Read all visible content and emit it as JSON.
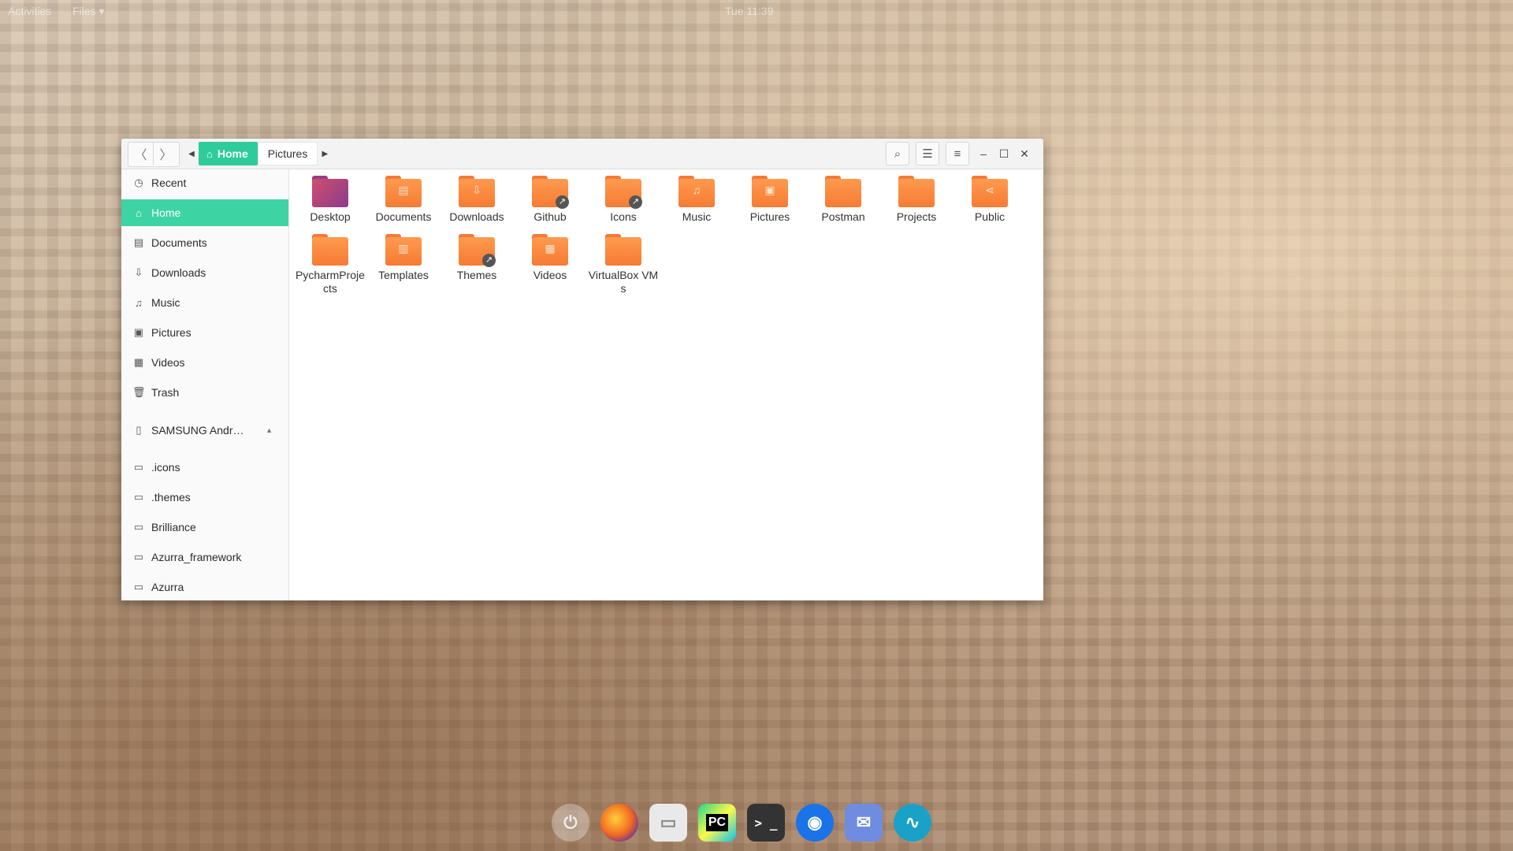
{
  "topbar": {
    "activities": "Activities",
    "app": "Files ▾",
    "clock": "Tue 11:39"
  },
  "window": {
    "nav": {
      "back": "〈",
      "forward": "〉"
    },
    "breadcrumb": {
      "left_arrow": "◀",
      "home_label": "Home",
      "current": "Pictures",
      "right_arrow": "▶"
    },
    "tools": {
      "search": "⌕",
      "view": "☰",
      "menu": "≡"
    },
    "wm": {
      "minimize": "–",
      "maximize": "☐",
      "close": "✕"
    }
  },
  "sidebar": {
    "items": [
      {
        "label": "Recent",
        "icon": "◷"
      },
      {
        "label": "Home",
        "icon": "⌂"
      },
      {
        "label": "Documents",
        "icon": "▤"
      },
      {
        "label": "Downloads",
        "icon": "⇩"
      },
      {
        "label": "Music",
        "icon": "♫"
      },
      {
        "label": "Pictures",
        "icon": "▣"
      },
      {
        "label": "Videos",
        "icon": "▦"
      },
      {
        "label": "Trash",
        "icon": "🗑"
      }
    ],
    "device": {
      "label": "SAMSUNG Andr…",
      "icon": "▯",
      "eject": "▲"
    },
    "bookmarks": [
      {
        "label": ".icons",
        "icon": "▭"
      },
      {
        "label": ".themes",
        "icon": "▭"
      },
      {
        "label": "Brilliance",
        "icon": "▭"
      },
      {
        "label": "Azurra_framework",
        "icon": "▭"
      },
      {
        "label": "Azurra",
        "icon": "▭"
      }
    ]
  },
  "files": [
    {
      "label": "Desktop",
      "glyph": ""
    },
    {
      "label": "Documents",
      "glyph": "▤"
    },
    {
      "label": "Downloads",
      "glyph": "⇩"
    },
    {
      "label": "Github",
      "glyph": "",
      "link": "↗"
    },
    {
      "label": "Icons",
      "glyph": "",
      "link": "↗"
    },
    {
      "label": "Music",
      "glyph": "♫"
    },
    {
      "label": "Pictures",
      "glyph": "▣"
    },
    {
      "label": "Postman",
      "glyph": ""
    },
    {
      "label": "Projects",
      "glyph": ""
    },
    {
      "label": "Public",
      "glyph": "⋖"
    },
    {
      "label": "PycharmProjects",
      "glyph": ""
    },
    {
      "label": "Templates",
      "glyph": "▥"
    },
    {
      "label": "Themes",
      "glyph": "",
      "link": "↗"
    },
    {
      "label": "Videos",
      "glyph": "▦"
    },
    {
      "label": "VirtualBox VMs",
      "glyph": ""
    }
  ],
  "dock": {
    "power": "⏻",
    "firefox": "",
    "files": "▭",
    "pycharm": "PC",
    "terminal": "> _",
    "target": "◉",
    "mail": "✉",
    "wave": "∿"
  }
}
